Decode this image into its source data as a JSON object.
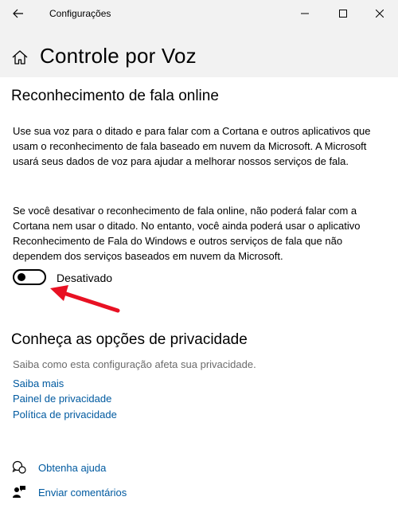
{
  "window": {
    "title": "Configurações",
    "back_icon": "arrow-left-icon",
    "minimize_icon": "minimize-icon",
    "maximize_icon": "maximize-icon",
    "close_icon": "close-icon"
  },
  "header": {
    "home_icon": "home-icon",
    "title": "Controle por Voz"
  },
  "online_speech": {
    "heading": "Reconhecimento de fala online",
    "paragraph1": "Use sua voz para o ditado e para falar com a Cortana e outros aplicativos que usam o reconhecimento de fala baseado em nuvem da Microsoft. A Microsoft usará seus dados de voz para ajudar a melhorar nossos serviços de fala.",
    "paragraph2": "Se você desativar o reconhecimento de fala online, não poderá falar com a Cortana nem usar o ditado. No entanto, você ainda poderá usar o aplicativo Reconhecimento de Fala do Windows e outros serviços de fala que não dependem dos serviços baseados em nuvem da Microsoft.",
    "toggle_state": "off",
    "toggle_label": "Desativado",
    "annotation_arrow_color": "#e81123"
  },
  "privacy": {
    "heading": "Conheça as opções de privacidade",
    "subtext": "Saiba como esta configuração afeta sua privacidade.",
    "links": [
      "Saiba mais",
      "Painel de privacidade",
      "Política de privacidade"
    ]
  },
  "help": {
    "get_help_icon": "chat-help-icon",
    "get_help": "Obtenha ajuda",
    "feedback_icon": "feedback-person-icon",
    "feedback": "Enviar comentários"
  },
  "colors": {
    "link": "#005aa0",
    "header_bg": "#f2f2f2"
  }
}
